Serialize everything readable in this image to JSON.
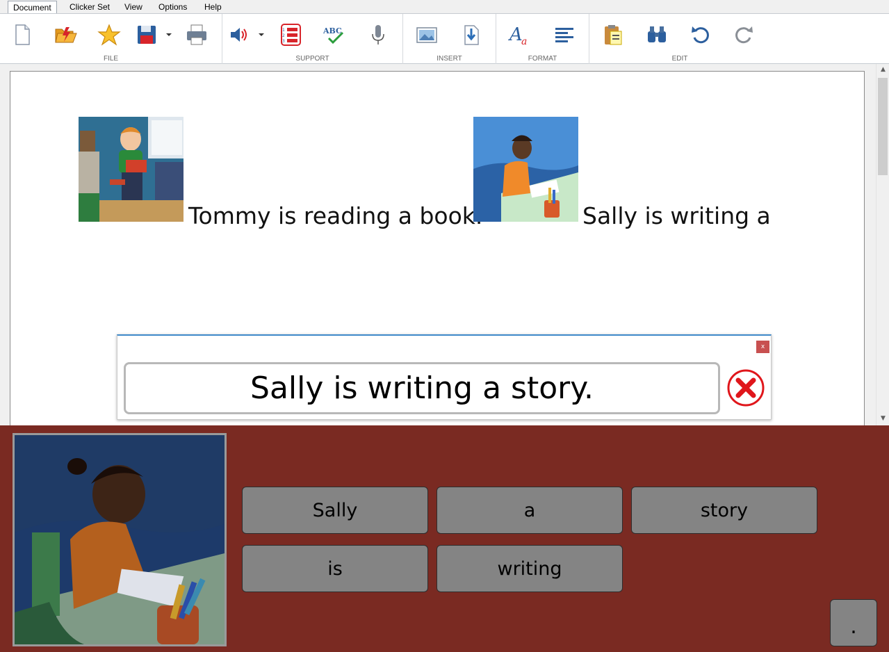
{
  "menu": {
    "tabs": [
      {
        "label": "Document"
      },
      {
        "label": "Clicker Set"
      },
      {
        "label": "View"
      },
      {
        "label": "Options"
      },
      {
        "label": "Help"
      }
    ]
  },
  "ribbon": {
    "groups": {
      "file": "FILE",
      "support": "SUPPORT",
      "insert": "INSERT",
      "format": "FORMAT",
      "edit": "EDIT"
    },
    "icons": {
      "file": [
        "new-document-icon",
        "open-folder-icon",
        "favourites-star-icon",
        "save-disk-icon",
        "print-icon"
      ],
      "support": [
        "speech-volume-icon",
        "numbered-list-icon",
        "spellcheck-icon",
        "microphone-icon"
      ],
      "insert": [
        "insert-picture-icon",
        "insert-file-icon"
      ],
      "format": [
        "font-style-icon",
        "align-text-icon"
      ],
      "edit": [
        "paste-clipboard-icon",
        "find-binoculars-icon",
        "undo-icon",
        "redo-icon"
      ]
    },
    "spellcheck_glyph": "ABC"
  },
  "document": {
    "sentence1": "Tommy is reading a book.",
    "sentence2": "Sally is writing a",
    "picture1": "boy-reading-picture",
    "picture2": "girl-writing-picture"
  },
  "popup": {
    "close_glyph": "x",
    "sentence": "Sally is writing a story."
  },
  "panel": {
    "picture": "girl-writing-picture",
    "words": [
      {
        "label": "Sally"
      },
      {
        "label": "a"
      },
      {
        "label": "story"
      },
      {
        "label": "is"
      },
      {
        "label": "writing"
      }
    ],
    "period": "."
  },
  "colors": {
    "panel_background": "#7a2a22",
    "word_cell": "#848484",
    "accent_blue": "#3e89c9",
    "clear_red": "#e0161b"
  }
}
